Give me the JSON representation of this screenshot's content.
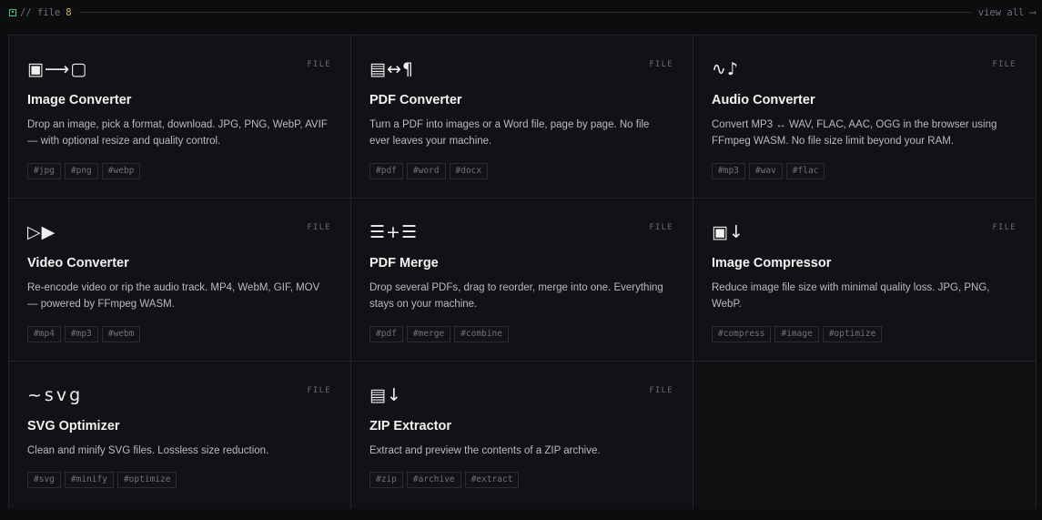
{
  "header": {
    "label": "// file",
    "count": "8",
    "view_all": "view all ⟶"
  },
  "cards": [
    {
      "icon": "▣⟶▢",
      "icon_name": "image-convert-icon",
      "tag": "FILE",
      "title": "Image Converter",
      "desc": "Drop an image, pick a format, download. JPG, PNG, WebP, AVIF — with optional resize and quality control.",
      "tags": [
        "#jpg",
        "#png",
        "#webp"
      ]
    },
    {
      "icon": "▤↔¶",
      "icon_name": "pdf-convert-icon",
      "tag": "FILE",
      "title": "PDF Converter",
      "desc": "Turn a PDF into images or a Word file, page by page. No file ever leaves your machine.",
      "tags": [
        "#pdf",
        "#word",
        "#docx"
      ]
    },
    {
      "icon": "∿♪",
      "icon_name": "audio-icon",
      "tag": "FILE",
      "title": "Audio Converter",
      "desc": "Convert MP3 ↔ WAV, FLAC, AAC, OGG in the browser using FFmpeg WASM. No file size limit beyond your RAM.",
      "tags": [
        "#mp3",
        "#wav",
        "#flac"
      ]
    },
    {
      "icon": "▷▶",
      "icon_name": "video-play-icon",
      "tag": "FILE",
      "title": "Video Converter",
      "desc": "Re-encode video or rip the audio track. MP4, WebM, GIF, MOV — powered by FFmpeg WASM.",
      "tags": [
        "#mp4",
        "#mp3",
        "#webm"
      ]
    },
    {
      "icon": "☰+☰",
      "icon_name": "merge-icon",
      "tag": "FILE",
      "title": "PDF Merge",
      "desc": "Drop several PDFs, drag to reorder, merge into one. Everything stays on your machine.",
      "tags": [
        "#pdf",
        "#merge",
        "#combine"
      ]
    },
    {
      "icon": "▣↓",
      "icon_name": "compress-icon",
      "tag": "FILE",
      "title": "Image Compressor",
      "desc": "Reduce image file size with minimal quality loss. JPG, PNG, WebP.",
      "tags": [
        "#compress",
        "#image",
        "#optimize"
      ]
    },
    {
      "icon": "~svg",
      "icon_name": "svg-icon",
      "tag": "FILE",
      "title": "SVG Optimizer",
      "desc": "Clean and minify SVG files. Lossless size reduction.",
      "tags": [
        "#svg",
        "#minify",
        "#optimize"
      ]
    },
    {
      "icon": "▤↓",
      "icon_name": "zip-extract-icon",
      "tag": "FILE",
      "title": "ZIP Extractor",
      "desc": "Extract and preview the contents of a ZIP archive.",
      "tags": [
        "#zip",
        "#archive",
        "#extract"
      ]
    }
  ]
}
